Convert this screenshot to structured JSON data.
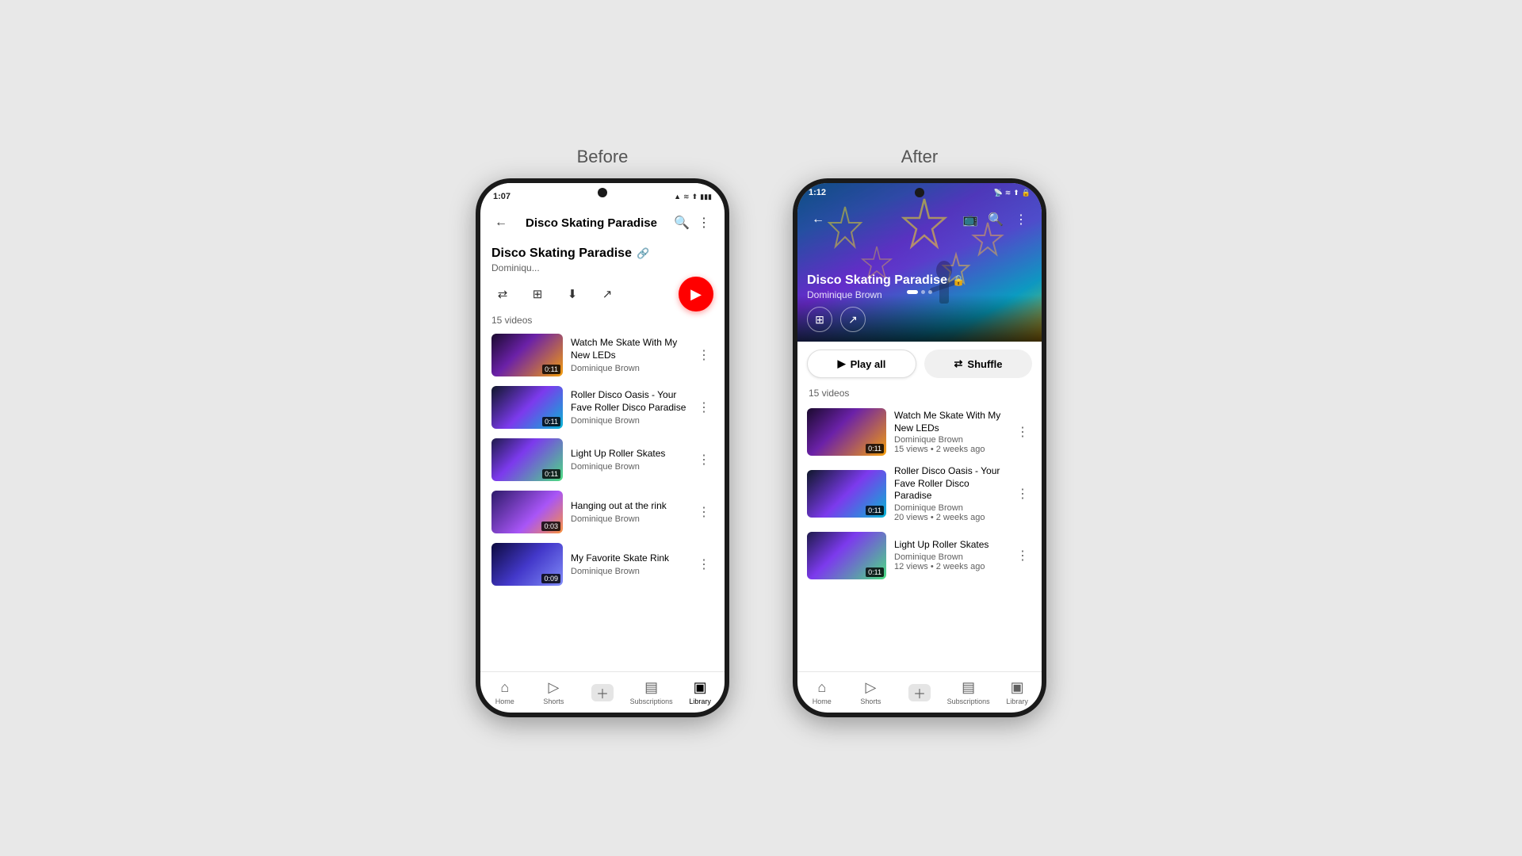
{
  "page": {
    "background": "#e8e8e8"
  },
  "before": {
    "label": "Before",
    "status": {
      "time": "1:07",
      "icons": "▲ ≋ ⬆ 🔋"
    },
    "nav": {
      "title": "Disco Skating Paradise"
    },
    "playlist": {
      "title": "Disco Skating Paradise",
      "author": "Dominiqu...",
      "video_count": "15 videos"
    },
    "actions": {
      "shuffle": "⇄",
      "add": "＋",
      "download": "⬇",
      "share": "↗"
    },
    "videos": [
      {
        "title": "Watch Me Skate With My New LEDs",
        "channel": "Dominique Brown",
        "duration": "0:11",
        "thumb_class": "thumb-before-1"
      },
      {
        "title": "Roller Disco Oasis - Your Fave Roller Disco Paradise",
        "channel": "Dominique Brown",
        "duration": "0:11",
        "thumb_class": "thumb-before-2"
      },
      {
        "title": "Light Up Roller Skates",
        "channel": "Dominique Brown",
        "duration": "0:11",
        "thumb_class": "thumb-before-3"
      },
      {
        "title": "Hanging out at the rink",
        "channel": "Dominique Brown",
        "duration": "0:03",
        "thumb_class": "thumb-before-4"
      },
      {
        "title": "My Favorite Skate Rink",
        "channel": "Dominique Brown",
        "duration": "0:09",
        "thumb_class": "thumb-before-5"
      }
    ],
    "bottom_nav": [
      {
        "icon": "⌂",
        "label": "Home",
        "active": false
      },
      {
        "icon": "▷",
        "label": "Shorts",
        "active": false
      },
      {
        "icon": "＋",
        "label": "",
        "active": false
      },
      {
        "icon": "▤",
        "label": "Subscriptions",
        "active": false
      },
      {
        "icon": "▣",
        "label": "Library",
        "active": true
      }
    ]
  },
  "after": {
    "label": "After",
    "status": {
      "time": "1:12",
      "icons": "📡 ≋ ⬆ 🔒"
    },
    "playlist": {
      "title": "Disco Skating Paradise",
      "author": "Dominique Brown",
      "video_count": "15 videos"
    },
    "buttons": {
      "play_all": "Play all",
      "shuffle": "Shuffle"
    },
    "videos": [
      {
        "title": "Watch Me Skate With My New LEDs",
        "channel": "Dominique Brown",
        "meta": "15 views • 2 weeks ago",
        "duration": "0:11",
        "thumb_class": "thumb-after-1"
      },
      {
        "title": "Roller Disco Oasis - Your Fave Roller Disco Paradise",
        "channel": "Dominique Brown",
        "meta": "20 views • 2 weeks ago",
        "duration": "0:11",
        "thumb_class": "thumb-after-2"
      },
      {
        "title": "Light Up Roller Skates",
        "channel": "Dominique Brown",
        "meta": "12 views • 2 weeks ago",
        "duration": "0:11",
        "thumb_class": "thumb-after-3"
      }
    ],
    "bottom_nav": [
      {
        "icon": "⌂",
        "label": "Home",
        "active": false
      },
      {
        "icon": "▷",
        "label": "Shorts",
        "active": false
      },
      {
        "icon": "＋",
        "label": "",
        "active": false
      },
      {
        "icon": "▤",
        "label": "Subscriptions",
        "active": false
      },
      {
        "icon": "▣",
        "label": "Library",
        "active": false
      }
    ]
  }
}
